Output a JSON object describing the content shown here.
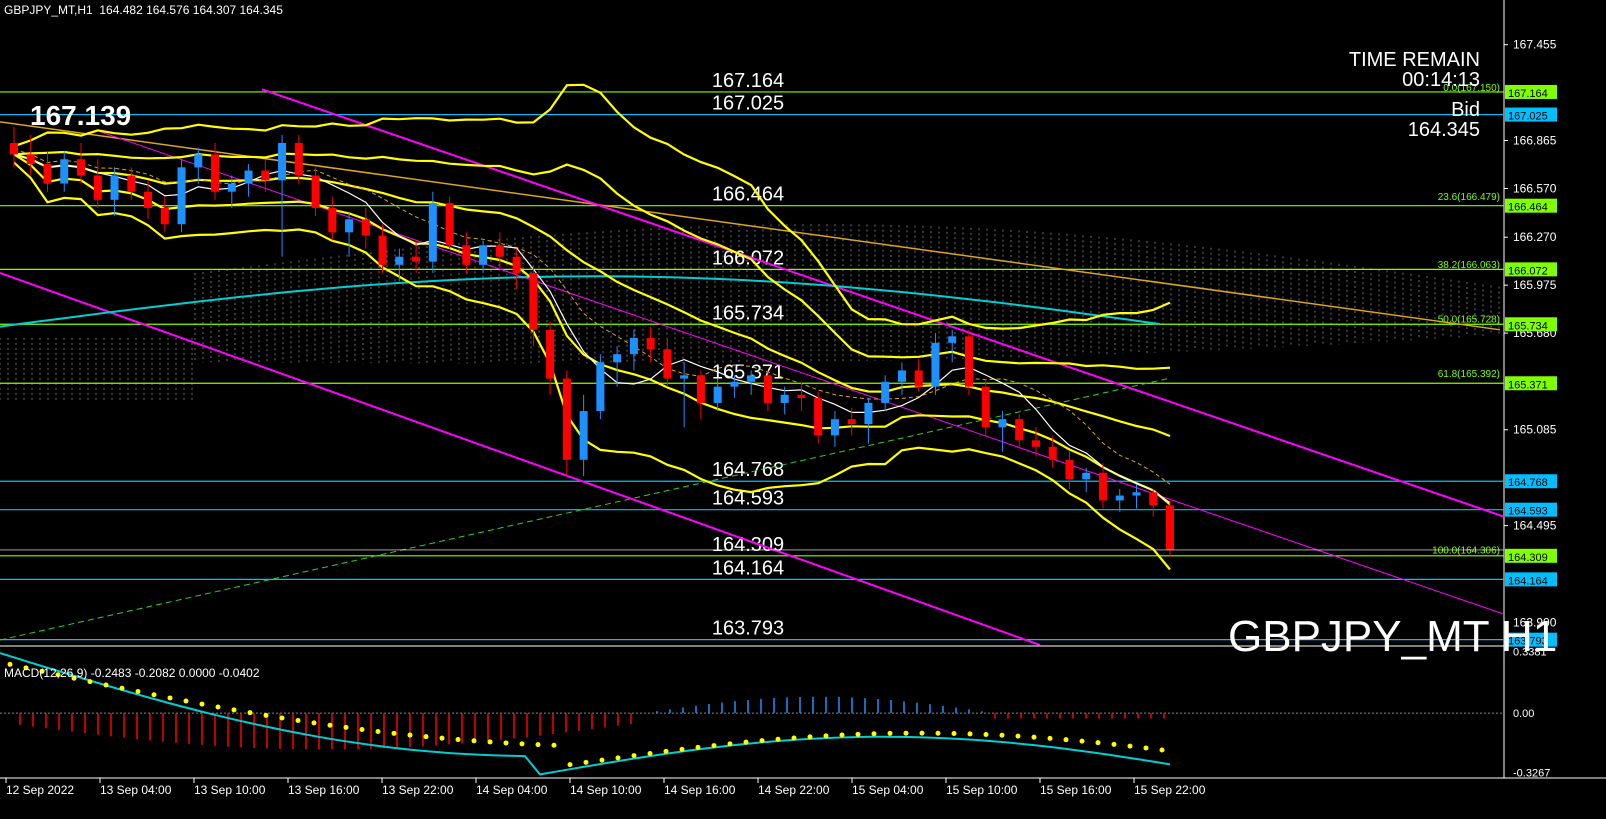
{
  "header": {
    "title": "GBPJPY_MT,H1  164.482 164.576 164.307 164.345"
  },
  "overlay": {
    "last_price_big": "167.139",
    "time_remain_label": "TIME REMAIN",
    "time_remain_value": "00:14:13",
    "bid_label": "Bid",
    "bid_value": "164.345",
    "symbol_label": "GBPJPY_MT H1"
  },
  "colors": {
    "background": "#000000",
    "bull_candle": "#1e90ff",
    "bear_candle": "#ff0000",
    "hline_green": "#7fff00",
    "hline_cyan": "#00bfff",
    "bollinger": "#ffff00",
    "channel": "#ff00ff",
    "ma_cyan": "#00ced1",
    "trendline": "#daa520",
    "macd_line": "#00ced1",
    "macd_signal": "#ffff00"
  },
  "chart_data": {
    "type": "candlestick",
    "price_axis_ticks": [
      "167.455",
      "166.865",
      "166.570",
      "166.270",
      "165.975",
      "165.680",
      "165.085",
      "164.495",
      "163.900"
    ],
    "time_axis_labels": [
      "12 Sep 2022",
      "13 Sep 04:00",
      "13 Sep 10:00",
      "13 Sep 16:00",
      "13 Sep 22:00",
      "14 Sep 04:00",
      "14 Sep 10:00",
      "14 Sep 16:00",
      "14 Sep 22:00",
      "15 Sep 04:00",
      "15 Sep 10:00",
      "15 Sep 16:00",
      "15 Sep 22:00"
    ],
    "horizontal_levels": [
      {
        "label": "167.164",
        "price": 167.164,
        "color": "green"
      },
      {
        "label": "167.025",
        "price": 167.025,
        "color": "cyan"
      },
      {
        "label": "166.464",
        "price": 166.464,
        "color": "green"
      },
      {
        "label": "166.072",
        "price": 166.072,
        "color": "green"
      },
      {
        "label": "165.734",
        "price": 165.734,
        "color": "green"
      },
      {
        "label": "165.371",
        "price": 165.371,
        "color": "green"
      },
      {
        "label": "164.768",
        "price": 164.768,
        "color": "cyan"
      },
      {
        "label": "164.593",
        "price": 164.593,
        "color": "cyan"
      },
      {
        "label": "164.309",
        "price": 164.309,
        "color": "green"
      },
      {
        "label": "164.164",
        "price": 164.164,
        "color": "cyan"
      },
      {
        "label": "163.793",
        "price": 163.793,
        "color": "cyan"
      }
    ],
    "fibonacci": [
      {
        "label": "0.0(167.150)",
        "price": 167.15
      },
      {
        "label": "23.6(166.479)",
        "price": 166.479
      },
      {
        "label": "38.2(166.063)",
        "price": 166.063
      },
      {
        "label": "50.0(165.728)",
        "price": 165.728
      },
      {
        "label": "61.8(165.392)",
        "price": 165.392
      },
      {
        "label": "100.0(164.306)",
        "price": 164.306
      }
    ],
    "candles": [
      [
        166.85,
        166.95,
        166.7,
        166.78
      ],
      [
        166.78,
        166.9,
        166.65,
        166.72
      ],
      [
        166.72,
        166.8,
        166.55,
        166.6
      ],
      [
        166.6,
        166.8,
        166.55,
        166.75
      ],
      [
        166.75,
        166.85,
        166.6,
        166.65
      ],
      [
        166.65,
        166.75,
        166.45,
        166.5
      ],
      [
        166.5,
        166.7,
        166.4,
        166.65
      ],
      [
        166.65,
        166.7,
        166.5,
        166.55
      ],
      [
        166.55,
        166.62,
        166.38,
        166.45
      ],
      [
        166.45,
        166.52,
        166.3,
        166.35
      ],
      [
        166.35,
        166.75,
        166.3,
        166.7
      ],
      [
        166.7,
        166.82,
        166.6,
        166.78
      ],
      [
        166.78,
        166.85,
        166.5,
        166.55
      ],
      [
        166.55,
        166.65,
        166.45,
        166.6
      ],
      [
        166.6,
        166.72,
        166.52,
        166.68
      ],
      [
        166.68,
        166.75,
        166.55,
        166.62
      ],
      [
        166.62,
        166.9,
        166.15,
        166.85
      ],
      [
        166.85,
        166.9,
        166.6,
        166.65
      ],
      [
        166.65,
        166.7,
        166.4,
        166.45
      ],
      [
        166.45,
        166.52,
        166.25,
        166.3
      ],
      [
        166.3,
        166.42,
        166.15,
        166.38
      ],
      [
        166.38,
        166.45,
        166.2,
        166.28
      ],
      [
        166.28,
        166.35,
        166.05,
        166.1
      ],
      [
        166.1,
        166.2,
        166.0,
        166.15
      ],
      [
        166.15,
        166.25,
        166.05,
        166.12
      ],
      [
        166.12,
        166.55,
        166.05,
        166.48
      ],
      [
        166.48,
        166.52,
        166.2,
        166.22
      ],
      [
        166.22,
        166.3,
        166.05,
        166.1
      ],
      [
        166.1,
        166.25,
        166.05,
        166.22
      ],
      [
        166.22,
        166.3,
        166.08,
        166.15
      ],
      [
        166.15,
        166.2,
        165.95,
        166.05
      ],
      [
        166.05,
        166.1,
        165.6,
        165.7
      ],
      [
        165.7,
        165.75,
        165.3,
        165.4
      ],
      [
        165.4,
        165.45,
        164.8,
        164.9
      ],
      [
        164.9,
        165.3,
        164.8,
        165.2
      ],
      [
        165.2,
        165.55,
        165.15,
        165.5
      ],
      [
        165.5,
        165.6,
        165.35,
        165.55
      ],
      [
        165.55,
        165.7,
        165.45,
        165.65
      ],
      [
        165.65,
        165.72,
        165.5,
        165.58
      ],
      [
        165.58,
        165.65,
        165.35,
        165.4
      ],
      [
        165.4,
        165.5,
        165.1,
        165.42
      ],
      [
        165.42,
        165.45,
        165.15,
        165.25
      ],
      [
        165.25,
        165.4,
        165.2,
        165.35
      ],
      [
        165.35,
        165.42,
        165.28,
        165.38
      ],
      [
        165.38,
        165.45,
        165.3,
        165.42
      ],
      [
        165.42,
        165.45,
        165.2,
        165.25
      ],
      [
        165.25,
        165.35,
        165.18,
        165.3
      ],
      [
        165.3,
        165.38,
        165.2,
        165.28
      ],
      [
        165.28,
        165.32,
        165.0,
        165.05
      ],
      [
        165.05,
        165.2,
        164.98,
        165.15
      ],
      [
        165.15,
        165.22,
        165.05,
        165.12
      ],
      [
        165.12,
        165.28,
        165.0,
        165.25
      ],
      [
        165.25,
        165.42,
        165.2,
        165.38
      ],
      [
        165.38,
        165.5,
        165.3,
        165.45
      ],
      [
        165.45,
        165.52,
        165.32,
        165.35
      ],
      [
        165.35,
        165.68,
        165.3,
        165.62
      ],
      [
        165.62,
        165.7,
        165.5,
        165.66
      ],
      [
        165.66,
        165.7,
        165.3,
        165.35
      ],
      [
        165.35,
        165.4,
        165.05,
        165.1
      ],
      [
        165.1,
        165.2,
        164.95,
        165.15
      ],
      [
        165.15,
        165.18,
        164.98,
        165.02
      ],
      [
        165.02,
        165.1,
        164.92,
        164.98
      ],
      [
        164.98,
        165.05,
        164.85,
        164.9
      ],
      [
        164.9,
        164.95,
        164.72,
        164.78
      ],
      [
        164.78,
        164.85,
        164.7,
        164.82
      ],
      [
        164.82,
        164.88,
        164.6,
        164.65
      ],
      [
        164.65,
        164.72,
        164.58,
        164.68
      ],
      [
        164.68,
        164.75,
        164.6,
        164.7
      ],
      [
        164.7,
        164.72,
        164.55,
        164.62
      ],
      [
        164.62,
        164.66,
        164.3,
        164.345
      ]
    ],
    "macd": {
      "label": "MACD(12,26,9) -0.2483 -0.2082 0.0000 -0.0402",
      "axis_ticks": [
        "0.3381",
        "0.00",
        "-0.3267"
      ],
      "range": [
        -0.3267,
        0.3381
      ]
    }
  }
}
